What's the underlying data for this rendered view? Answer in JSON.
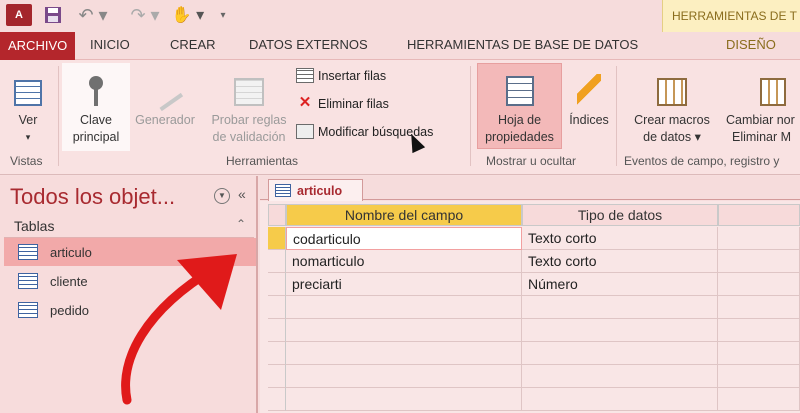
{
  "title_bar": {
    "app_badge": "A",
    "contextual_group": "HERRAMIENTAS DE T"
  },
  "tabs": [
    "ARCHIVO",
    "INICIO",
    "CREAR",
    "DATOS EXTERNOS",
    "HERRAMIENTAS DE BASE DE DATOS",
    "DISEÑO"
  ],
  "ribbon": {
    "ver": "Ver",
    "clave_line1": "Clave",
    "clave_line2": "principal",
    "generador": "Generador",
    "probar_line1": "Probar reglas",
    "probar_line2": "de validación",
    "insertar": "Insertar filas",
    "eliminar": "Eliminar filas",
    "modificar": "Modificar búsquedas",
    "hoja_line1": "Hoja de",
    "hoja_line2": "propiedades",
    "indices": "Índices",
    "crear_line1": "Crear macros",
    "crear_line2": "de datos ▾",
    "cambiar_line1": "Cambiar nor",
    "cambiar_line2": "Eliminar M",
    "groups": {
      "vistas": "Vistas",
      "herramientas": "Herramientas",
      "mostrar": "Mostrar u ocultar",
      "eventos": "Eventos de campo, registro y"
    }
  },
  "nav": {
    "title": "Todos los objet...",
    "section": "Tablas",
    "items": [
      "articulo",
      "cliente",
      "pedido"
    ],
    "selected": "articulo"
  },
  "document": {
    "tab": "articulo",
    "headers": [
      "Nombre del campo",
      "Tipo de datos",
      ""
    ],
    "rows": [
      {
        "name": "codarticulo",
        "type": "Texto corto",
        "key": true
      },
      {
        "name": "nomarticulo",
        "type": "Texto corto",
        "key": false
      },
      {
        "name": "preciarti",
        "type": "Número",
        "key": false
      }
    ]
  },
  "colors": {
    "accent": "#a82a30",
    "key_highlight": "#f6cb4a",
    "annotation_arrow": "#e01a1a"
  }
}
